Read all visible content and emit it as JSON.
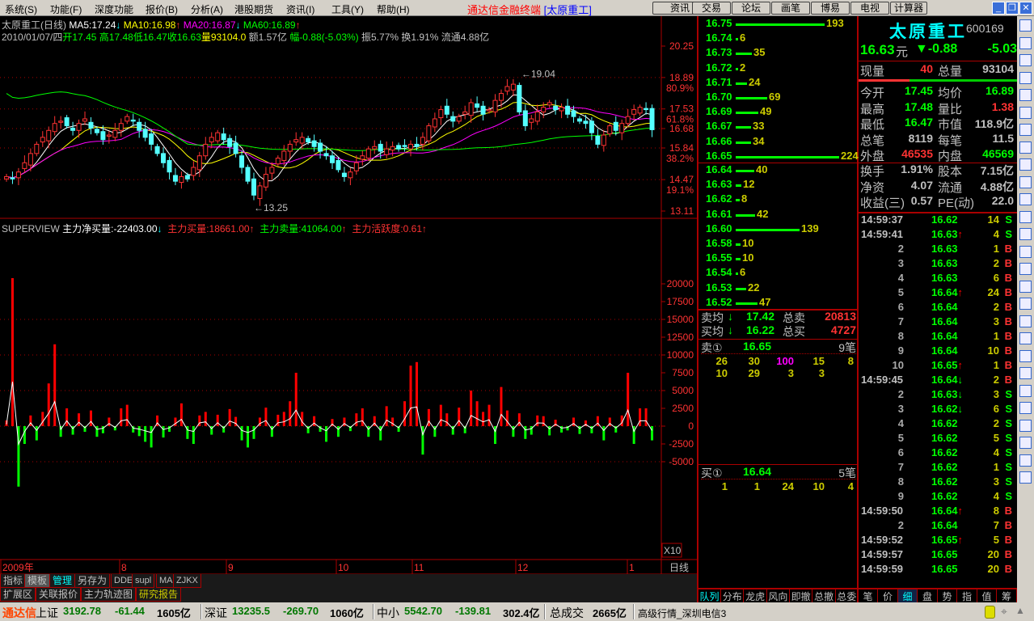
{
  "menu": [
    "系统(S)",
    "功能(F)",
    "深度功能",
    "报价(B)",
    "分析(A)",
    "港股期货",
    "资讯(I)",
    "工具(Y)",
    "帮助(H)"
  ],
  "app_title": "通达信金融终端",
  "app_title_stock": "[太原重工]",
  "toolbar": [
    "资讯",
    "交易",
    "论坛",
    "画笔",
    "博易",
    "电视",
    "计算器"
  ],
  "chart_header": {
    "name": "太原重工(日线)",
    "ma5": "MA5:17.24",
    "ma10": "MA10:16.98",
    "ma20": "MA20:16.87",
    "ma60": "MA60:16.89",
    "date": "2010/01/07/四",
    "open": "开17.45",
    "high": "高17.48",
    "low": "低16.47",
    "close": "收16.63",
    "vol": "量93104.0",
    "amount": "额1.57亿",
    "change": "幅-0.88(-5.03%)",
    "amp": "振5.77%",
    "turn": "换1.91%",
    "float": "流通4.88亿"
  },
  "price_axis": [
    "20.25",
    "18.89",
    "80.9%",
    "17.53",
    "61.8%",
    "16.68",
    "15.84",
    "38.2%",
    "14.47",
    "19.1%",
    "13.11"
  ],
  "price_annotations": {
    "high": "19.04",
    "low": "13.25"
  },
  "indicator_header": {
    "name": "SUPERVIEW",
    "net": "主力净买量:-22403.00",
    "buy": "主力买量:18661.00",
    "sell": "主力卖量:41064.00",
    "active": "主力活跃度:0.61"
  },
  "indicator_axis": [
    "20000",
    "17500",
    "15000",
    "12500",
    "10000",
    "7500",
    "5000",
    "2500",
    "0",
    "-2500",
    "-5000"
  ],
  "x10": "X10",
  "date_axis": [
    "2009年",
    "8",
    "9",
    "10",
    "11",
    "12",
    "1"
  ],
  "period": "日线",
  "tabs1": [
    "指标",
    "模板",
    "管理",
    "另存为",
    "DDE",
    "supl",
    "MA",
    "ZJKX"
  ],
  "tabs2": [
    "扩展区",
    "关联报价",
    "主力轨迹图",
    "研究报告"
  ],
  "orderbook": {
    "sell": [
      [
        "16.75",
        "193"
      ],
      [
        "16.74",
        "6"
      ],
      [
        "16.73",
        "35"
      ],
      [
        "16.72",
        "2"
      ],
      [
        "16.71",
        "24"
      ],
      [
        "16.70",
        "69"
      ],
      [
        "16.69",
        "49"
      ],
      [
        "16.67",
        "33"
      ],
      [
        "16.66",
        "34"
      ],
      [
        "16.65",
        "224"
      ]
    ],
    "buy": [
      [
        "16.64",
        "40"
      ],
      [
        "16.63",
        "12"
      ],
      [
        "16.62",
        "8"
      ],
      [
        "16.61",
        "42"
      ],
      [
        "16.60",
        "139"
      ],
      [
        "16.58",
        "10"
      ],
      [
        "16.55",
        "10"
      ],
      [
        "16.54",
        "6"
      ],
      [
        "16.53",
        "22"
      ],
      [
        "16.52",
        "47"
      ]
    ],
    "sell_avg_label": "卖均",
    "sell_avg": "17.42",
    "total_sell_label": "总卖",
    "total_sell": "20813",
    "buy_avg_label": "买均",
    "buy_avg": "16.22",
    "total_buy_label": "总买",
    "total_buy": "4727",
    "ask1_label": "卖①",
    "ask1": "16.65",
    "ask1_count": "9笔",
    "ask1_queue": [
      "26",
      "30",
      "100",
      "15",
      "8",
      "10",
      "29",
      "3",
      "3"
    ],
    "bid1_label": "买①",
    "bid1": "16.64",
    "bid1_count": "5笔",
    "bid1_queue": [
      "1",
      "1",
      "24",
      "10",
      "4"
    ],
    "tabs": [
      "队列",
      "分布",
      "龙虎",
      "风向",
      "即撤",
      "总撤",
      "总委"
    ]
  },
  "quote": {
    "name": "太原重工",
    "code": "600169",
    "price": "16.63",
    "unit": "元",
    "change": "▼-0.88",
    "pct": "-5.03",
    "rows1": [
      [
        "现量",
        "40",
        "总量",
        "93104"
      ]
    ],
    "rows2": [
      [
        "今开",
        "17.45",
        "均价",
        "16.89"
      ],
      [
        "最高",
        "17.48",
        "量比",
        "1.38"
      ],
      [
        "最低",
        "16.47",
        "市值",
        "118.9亿"
      ],
      [
        "总笔",
        "8119",
        "每笔",
        "11.5"
      ],
      [
        "外盘",
        "46535",
        "内盘",
        "46569"
      ]
    ],
    "rows3": [
      [
        "换手",
        "1.91%",
        "股本",
        "7.15亿"
      ],
      [
        "净资",
        "4.07",
        "流通",
        "4.88亿"
      ],
      [
        "收益(三)",
        "0.57",
        "PE(动)",
        "22.0"
      ]
    ]
  },
  "ticks": [
    [
      "14:59:37",
      "16.62",
      "",
      "14",
      "S"
    ],
    [
      "14:59:41",
      "16.63",
      "↑",
      "4",
      "S"
    ],
    [
      "2",
      "16.63",
      "",
      "1",
      "B"
    ],
    [
      "3",
      "16.63",
      "",
      "2",
      "B"
    ],
    [
      "4",
      "16.63",
      "",
      "6",
      "B"
    ],
    [
      "5",
      "16.64",
      "↑",
      "24",
      "B"
    ],
    [
      "6",
      "16.64",
      "",
      "2",
      "B"
    ],
    [
      "7",
      "16.64",
      "",
      "3",
      "B"
    ],
    [
      "8",
      "16.64",
      "",
      "1",
      "B"
    ],
    [
      "9",
      "16.64",
      "",
      "10",
      "B"
    ],
    [
      "10",
      "16.65",
      "↑",
      "1",
      "B"
    ],
    [
      "14:59:45",
      "16.64",
      "↓",
      "2",
      "B"
    ],
    [
      "2",
      "16.63",
      "↓",
      "3",
      "S"
    ],
    [
      "3",
      "16.62",
      "↓",
      "6",
      "S"
    ],
    [
      "4",
      "16.62",
      "",
      "2",
      "S"
    ],
    [
      "5",
      "16.62",
      "",
      "5",
      "S"
    ],
    [
      "6",
      "16.62",
      "",
      "4",
      "S"
    ],
    [
      "7",
      "16.62",
      "",
      "1",
      "S"
    ],
    [
      "8",
      "16.62",
      "",
      "3",
      "S"
    ],
    [
      "9",
      "16.62",
      "",
      "4",
      "S"
    ],
    [
      "14:59:50",
      "16.64",
      "↑",
      "8",
      "B"
    ],
    [
      "2",
      "16.64",
      "",
      "7",
      "B"
    ],
    [
      "14:59:52",
      "16.65",
      "↑",
      "5",
      "B"
    ],
    [
      "14:59:57",
      "16.65",
      "",
      "20",
      "B"
    ],
    [
      "14:59:59",
      "16.65",
      "",
      "20",
      "B"
    ]
  ],
  "quote_tabs": [
    "笔",
    "价",
    "细",
    "盘",
    "势",
    "指",
    "值",
    "筹"
  ],
  "status": {
    "brand": "通达信",
    "sh_label": "上证",
    "sh": "3192.78",
    "sh_chg": "-61.44",
    "sh_amt": "1605亿",
    "sz_label": "深证",
    "sz": "13235.5",
    "sz_chg": "-269.70",
    "sz_amt": "1060亿",
    "zx_label": "中小",
    "zx": "5542.70",
    "zx_chg": "-139.81",
    "zx_amt": "302.4亿",
    "total_label": "总成交",
    "total": "2665亿",
    "server": "高级行情_深圳电信3"
  },
  "chart_data": {
    "type": "candlestick",
    "price_range": [
      13.11,
      20.25
    ],
    "closes": [
      14.6,
      14.5,
      14.8,
      15.2,
      15.6,
      16.0,
      16.3,
      16.6,
      16.9,
      17.0,
      16.8,
      16.6,
      16.9,
      17.1,
      16.7,
      16.5,
      16.2,
      16.4,
      16.6,
      16.9,
      17.2,
      17.0,
      16.6,
      16.3,
      16.0,
      15.6,
      15.2,
      14.8,
      14.4,
      14.6,
      14.5,
      15.0,
      15.5,
      16.0,
      16.3,
      16.5,
      16.2,
      15.9,
      15.6,
      15.0,
      14.4,
      13.8,
      14.2,
      14.7,
      15.0,
      15.4,
      15.7,
      16.0,
      16.2,
      16.3,
      16.1,
      15.9,
      15.7,
      15.5,
      15.2,
      14.9,
      14.6,
      14.8,
      15.2,
      15.5,
      15.8,
      15.9,
      15.7,
      15.8,
      15.9,
      15.8,
      15.9,
      16.0,
      15.9,
      16.3,
      16.8,
      17.1,
      17.5,
      17.3,
      17.0,
      17.2,
      17.4,
      17.8,
      17.6,
      17.3,
      17.5,
      17.9,
      18.2,
      18.5,
      18.6,
      17.4,
      16.8,
      17.1,
      17.4,
      17.6,
      17.8,
      17.5,
      17.6,
      17.3,
      17.2,
      17.0,
      16.9,
      16.5,
      16.0,
      16.4,
      16.8,
      16.6,
      16.9,
      17.2,
      17.5,
      17.6,
      17.5,
      16.63
    ],
    "net_buy": [
      800,
      20800,
      -8500,
      -2500,
      1500,
      -2000,
      2000,
      6000,
      11500,
      -1500,
      2500,
      -1200,
      1800,
      -800,
      2200,
      -1500,
      -1000,
      1200,
      -600,
      2500,
      3000,
      -900,
      -1400,
      -2200,
      -3000,
      1500,
      -1600,
      -800,
      1200,
      3200,
      -1800,
      -2500,
      1500,
      2000,
      -1200,
      1600,
      -900,
      2400,
      1300,
      -2000,
      -3000,
      -1800,
      1200,
      2600,
      -1500,
      1600,
      2000,
      3500,
      7500,
      2000,
      -1000,
      1400,
      -800,
      -2200,
      1000,
      -1500,
      1200,
      -700,
      1800,
      2500,
      -1500,
      1400,
      -2000,
      2800,
      1200,
      -800,
      3500,
      8500,
      9000,
      -4000,
      2400,
      -1500,
      3000,
      1800,
      -1200,
      2600,
      -1000,
      5000,
      3500,
      2000,
      3000,
      -2500,
      5500,
      2200,
      -1500,
      1800,
      -1800,
      -1200,
      1500,
      1400,
      -1300,
      900,
      -900,
      -600,
      1200,
      -1100,
      800,
      -1000,
      1400,
      -2000,
      1200,
      -900,
      1500,
      7500,
      -2500,
      2500,
      2500,
      -2000
    ],
    "ylim": [
      -5000,
      20000
    ]
  }
}
